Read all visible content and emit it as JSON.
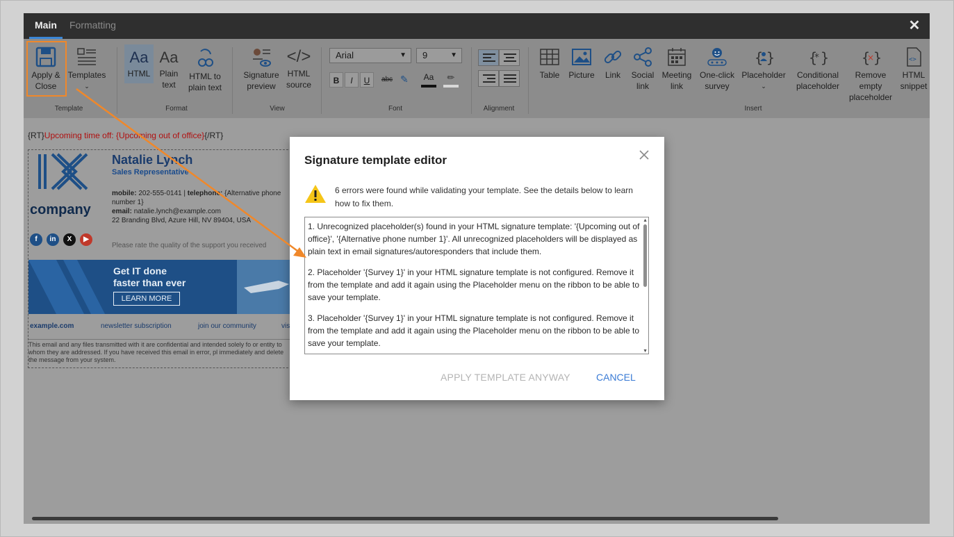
{
  "tabs": {
    "main": "Main",
    "formatting": "Formatting"
  },
  "ribbon": {
    "template_group": {
      "label": "Template",
      "apply_close": "Apply & Close",
      "templates": "Templates"
    },
    "format_group": {
      "label": "Format",
      "html": "HTML",
      "plain_text": "Plain text",
      "html_to_plain": "HTML to plain text"
    },
    "view_group": {
      "label": "View",
      "signature_preview": "Signature preview",
      "html_source": "HTML source"
    },
    "font_group": {
      "label": "Font",
      "font_family": "Arial",
      "font_size": "9",
      "bold": "B",
      "italic": "I",
      "underline": "U",
      "strike": "abc"
    },
    "alignment_group": {
      "label": "Alignment"
    },
    "insert_group": {
      "label": "Insert",
      "table": "Table",
      "picture": "Picture",
      "link": "Link",
      "social_link": "Social link",
      "meeting_link": "Meeting link",
      "one_click_survey": "One-click survey",
      "placeholder": "Placeholder",
      "conditional_placeholder": "Conditional placeholder",
      "remove_empty_placeholder": "Remove empty placeholder",
      "html_snippet": "HTML snippet"
    }
  },
  "document": {
    "rt_open": "{RT}",
    "rt_text": "Upcoming time off: {Upcoming out of office}",
    "rt_close": "{/RT}",
    "name": "Natalie Lynch",
    "title": "Sales Representative",
    "mobile_label": "mobile:",
    "mobile_value": "202-555-0141 |",
    "telephone_label": "telephone:",
    "telephone_value": "{Alternative phone number 1}",
    "email_label": "email:",
    "email_value": "natalie.lynch@example.com",
    "address": "22 Branding Blvd, Azure Hill, NV 89404, USA",
    "rate_text": "Please rate the quality of the support you received",
    "logo_text": "company",
    "banner_line1": "Get IT done",
    "banner_line2": "faster than ever",
    "banner_button": "LEARN MORE",
    "links": [
      "example.com",
      "newsletter subscription",
      "join our community",
      "vis"
    ],
    "disclaimer": "This email and any files transmitted with it are confidential and intended solely fo or entity to whom they are addressed. If you have received this email in error, pl immediately and delete the message from your system."
  },
  "dialog": {
    "title": "Signature template editor",
    "warning": "6 errors were found while validating your template. See the details below to learn how to fix them.",
    "errors": [
      "1. Unrecognized placeholder(s) found in your HTML signature template: '{Upcoming out of office}', '{Alternative phone number 1}'. All unrecognized placeholders will be displayed as plain text in email signatures/autoresponders that include them.",
      "2. Placeholder '{Survey 1}' in your HTML signature template is not configured. Remove it from the template and add it again using the Placeholder menu on the ribbon to be able to save your template.",
      "3. Placeholder '{Survey 1}' in your HTML signature template is not configured. Remove it from the template and add it again using the Placeholder menu on the ribbon to be able to save your template."
    ],
    "apply_anyway": "APPLY TEMPLATE ANYWAY",
    "cancel": "CANCEL"
  },
  "colors": {
    "accent": "#3a7bd5",
    "highlight": "#f0882a",
    "brand_blue": "#1e4f86",
    "warning": "#f5c518"
  }
}
